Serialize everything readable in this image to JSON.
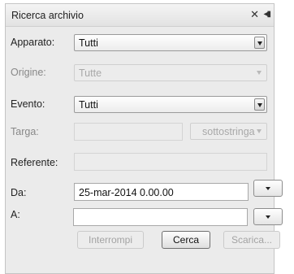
{
  "window": {
    "title": "Ricerca archivio",
    "close_icon": "close-icon",
    "menu_icon": "window-menu-icon"
  },
  "form": {
    "apparato": {
      "label": "Apparato:",
      "value": "Tutti"
    },
    "origine": {
      "label": "Origine:",
      "value": "Tutte"
    },
    "evento": {
      "label": "Evento:",
      "value": "Tutti"
    },
    "targa": {
      "label": "Targa:",
      "value": "",
      "mode": "sottostringa"
    },
    "referente": {
      "label": "Referente:",
      "value": ""
    },
    "da": {
      "label": "Da:",
      "value": "25-mar-2014 0.00.00"
    },
    "a": {
      "label": "A:",
      "value": ""
    }
  },
  "buttons": {
    "interrompi": "Interrompi",
    "cerca": "Cerca",
    "scarica": "Scarica..."
  },
  "colors": {
    "panel_bg": "#ebebeb",
    "disabled_text": "#a3a3a3"
  }
}
